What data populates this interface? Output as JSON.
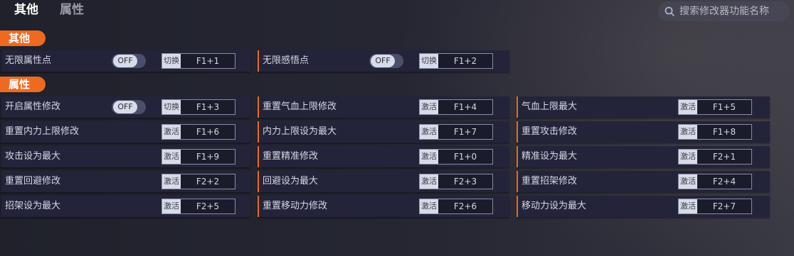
{
  "tabs": [
    {
      "label": "其他",
      "active": true
    },
    {
      "label": "属性",
      "active": false
    }
  ],
  "search": {
    "placeholder": "搜索修改器功能名称",
    "icon": "search-icon"
  },
  "sections": {
    "other": {
      "title": "其他"
    },
    "attr": {
      "title": "属性"
    }
  },
  "toggle_off": "OFF",
  "rows": {
    "r0": {
      "label": "无限属性点",
      "tag": "切换",
      "key": "F1+1"
    },
    "r1": {
      "label": "无限感悟点",
      "tag": "切换",
      "key": "F1+2"
    },
    "r2": {
      "label": "开启属性修改",
      "tag": "切换",
      "key": "F1+3"
    },
    "r3": {
      "label": "重置气血上限修改",
      "tag": "激活",
      "key": "F1+4"
    },
    "r4": {
      "label": "气血上限最大",
      "tag": "激活",
      "key": "F1+5"
    },
    "r5": {
      "label": "重置内力上限修改",
      "tag": "激活",
      "key": "F1+6"
    },
    "r6": {
      "label": "内力上限设为最大",
      "tag": "激活",
      "key": "F1+7"
    },
    "r7": {
      "label": "重置攻击修改",
      "tag": "激活",
      "key": "F1+8"
    },
    "r8": {
      "label": "攻击设为最大",
      "tag": "激活",
      "key": "F1+9"
    },
    "r9": {
      "label": "重置精准修改",
      "tag": "激活",
      "key": "F1+0"
    },
    "r10": {
      "label": "精准设为最大",
      "tag": "激活",
      "key": "F2+1"
    },
    "r11": {
      "label": "重置回避修改",
      "tag": "激活",
      "key": "F2+2"
    },
    "r12": {
      "label": "回避设为最大",
      "tag": "激活",
      "key": "F2+3"
    },
    "r13": {
      "label": "重置招架修改",
      "tag": "激活",
      "key": "F2+4"
    },
    "r14": {
      "label": "招架设为最大",
      "tag": "激活",
      "key": "F2+5"
    },
    "r15": {
      "label": "重置移动力修改",
      "tag": "激活",
      "key": "F2+6"
    },
    "r16": {
      "label": "移动力设为最大",
      "tag": "激活",
      "key": "F2+7"
    }
  },
  "colors": {
    "accent": "#ee6a21",
    "row_bg": "#23243a",
    "background": "#23242f"
  }
}
